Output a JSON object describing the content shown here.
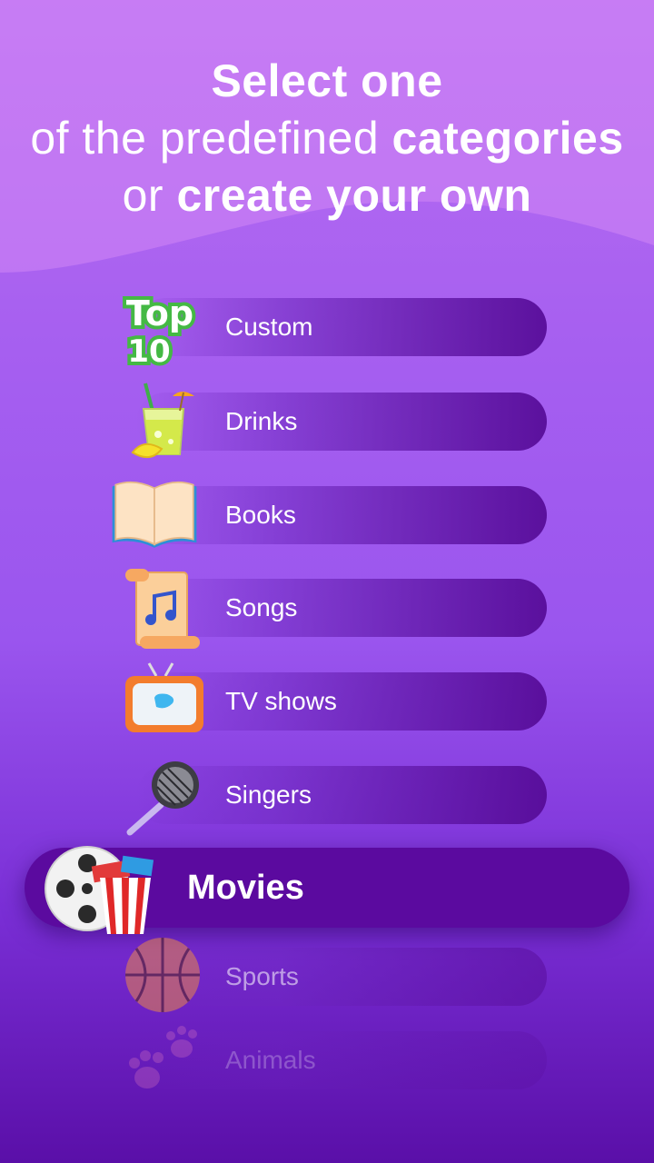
{
  "header": {
    "line1_bold": "Select one",
    "line2_light": "of the predefined ",
    "line2_bold": "categories",
    "line3_light": "or ",
    "line3_bold": "create your own"
  },
  "categories": [
    {
      "label": "Custom",
      "icon": "top10-icon"
    },
    {
      "label": "Drinks",
      "icon": "lemonade-icon"
    },
    {
      "label": "Books",
      "icon": "book-icon"
    },
    {
      "label": "Songs",
      "icon": "music-scroll-icon"
    },
    {
      "label": "TV shows",
      "icon": "tv-icon"
    },
    {
      "label": "Singers",
      "icon": "microphone-icon"
    },
    {
      "label": "Movies",
      "icon": "film-popcorn-icon",
      "selected": true
    },
    {
      "label": "Sports",
      "icon": "basketball-icon"
    },
    {
      "label": "Animals",
      "icon": "paw-icon"
    }
  ],
  "top10_text": {
    "top": "Top",
    "num": "10"
  },
  "colors": {
    "accent": "#5b0a9f",
    "background_top": "#b86ef2",
    "background_bottom": "#5a0fa8"
  }
}
